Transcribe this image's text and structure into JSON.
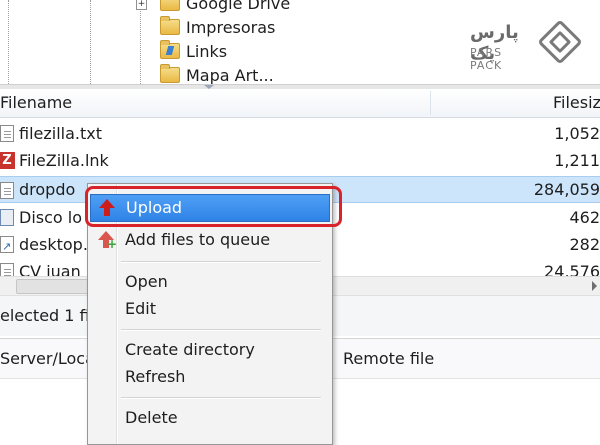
{
  "tree": {
    "items": [
      {
        "label": "Google Drive",
        "icon": "google-drive-folder-icon"
      },
      {
        "label": "Impresoras",
        "icon": "folder-icon"
      },
      {
        "label": "Links",
        "icon": "links-folder-icon"
      },
      {
        "label": "Mapa Art...",
        "icon": "folder-icon"
      }
    ]
  },
  "logo": {
    "fa_text": "پارس پک",
    "en_text": "PARS PACK"
  },
  "file_list": {
    "columns": {
      "filename": "Filename",
      "filesize": "Filesize"
    },
    "rows": [
      {
        "name": "filezilla.txt",
        "size": "1,052",
        "icon": "text-file-icon"
      },
      {
        "name": "FileZilla.lnk",
        "size": "1,211",
        "icon": "filezilla-icon"
      },
      {
        "name": "dropdo",
        "size": "284,059",
        "icon": "file-icon",
        "selected": true
      },
      {
        "name": "Disco lo",
        "size": "462",
        "icon": "disk-icon"
      },
      {
        "name": "desktop.",
        "size": "282",
        "icon": "settings-file-icon"
      },
      {
        "name": "CV juan",
        "size": "24,576",
        "icon": "document-icon"
      }
    ]
  },
  "status": {
    "text": "elected 1 fil"
  },
  "queue": {
    "columns": {
      "server_local": "Server/Loca",
      "remote_file": "Remote file"
    }
  },
  "context_menu": {
    "items": {
      "upload": "Upload",
      "add_to_queue": "Add files to queue",
      "open": "Open",
      "edit": "Edit",
      "create_directory": "Create directory",
      "refresh": "Refresh",
      "delete": "Delete"
    },
    "highlight_color": "#d8232a",
    "hover_color": "#3a8ee8"
  }
}
